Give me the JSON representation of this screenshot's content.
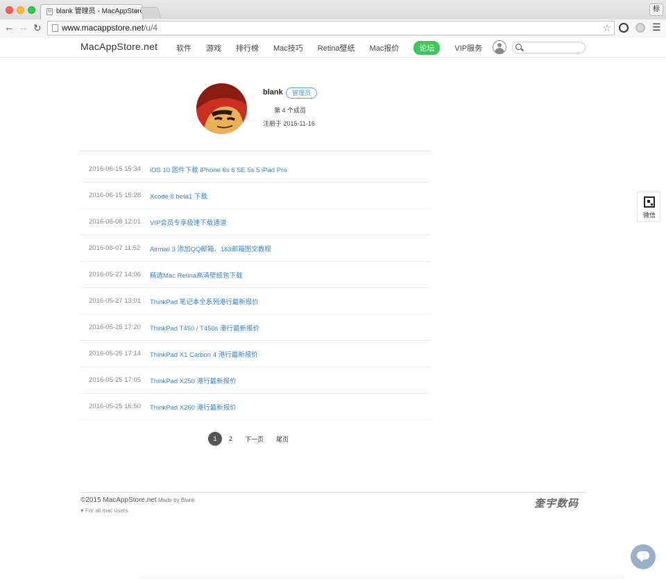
{
  "browser": {
    "tab_title": "blank 管理员 - MacAppStore.",
    "tab_close": "×",
    "url_host": "www.macappstore.net",
    "url_path": "/u/4",
    "corner_label": "标"
  },
  "site": {
    "logo": "MacAppStore.net",
    "menu": [
      {
        "label": "软件"
      },
      {
        "label": "游戏"
      },
      {
        "label": "排行榜"
      },
      {
        "label": "Mac技巧"
      },
      {
        "label": "Retina壁纸"
      },
      {
        "label": "Mac报价"
      },
      {
        "label": "论坛",
        "active": true
      },
      {
        "label": "VIP服务"
      }
    ],
    "search_placeholder": ""
  },
  "profile": {
    "username": "blank",
    "role_badge": "管理员",
    "member_number": "第 4 个成员",
    "joined": "注册于 2015-11-16"
  },
  "posts": [
    {
      "date": "2016-06-15 15:34",
      "title": "iOS 10 固件下载 iPhone 6s 6 SE 5s 5 iPad Pro"
    },
    {
      "date": "2016-06-15 15:28",
      "title": "Xcode 8 beta1 下载"
    },
    {
      "date": "2016-06-08 12:01",
      "title": "VIP会员专享极速下载通道"
    },
    {
      "date": "2016-06-07 11:52",
      "title": "Airmail 3 添加QQ邮箱、163邮箱图文教程"
    },
    {
      "date": "2016-05-27 14:06",
      "title": "精选Mac Retina高清壁纸包下载"
    },
    {
      "date": "2016-05-27 13:01",
      "title": "ThinkPad 笔记本全系列港行最新报价"
    },
    {
      "date": "2016-05-25 17:20",
      "title": "ThinkPad T450 / T450s 港行最新报价"
    },
    {
      "date": "2016-05-25 17:14",
      "title": "ThinkPad X1 Carbon 4 港行最新报价"
    },
    {
      "date": "2016-05-25 17:05",
      "title": "ThinkPad X250 港行最新报价"
    },
    {
      "date": "2016-05-25 16:50",
      "title": "ThinkPad X260 港行最新报价"
    }
  ],
  "pagination": {
    "current": "1",
    "page2": "2",
    "next": "下一页",
    "last": "尾页"
  },
  "footer": {
    "copyright": "©2015 MacAppStore.net",
    "made_by": " Made by Blank",
    "tagline": "♥ For all mac users.",
    "brand": "奎宇数码"
  },
  "side": {
    "wechat_label": "微信"
  },
  "colors": {
    "link": "#3b84c4",
    "active_nav": "#3dc75c",
    "badge": "#4a95c9"
  }
}
